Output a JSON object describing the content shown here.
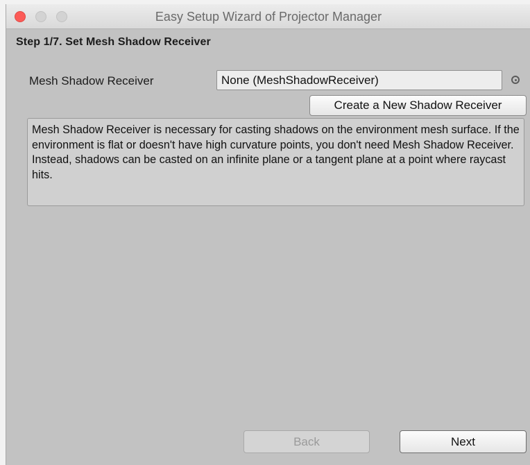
{
  "window": {
    "title": "Easy Setup Wizard of Projector Manager"
  },
  "step": {
    "label": "Step 1/7. Set Mesh Shadow Receiver"
  },
  "field": {
    "label": "Mesh Shadow Receiver",
    "value": "None (MeshShadowReceiver)"
  },
  "buttons": {
    "create": "Create a New Shadow Receiver",
    "back": "Back",
    "next": "Next"
  },
  "help": {
    "text": "Mesh Shadow Receiver is necessary for casting shadows on the environment mesh surface. If the environment is flat or doesn't have high curvature points, you don't need Mesh Shadow Receiver. Instead, shadows can be casted on an infinite plane or a tangent plane at a point where raycast hits."
  },
  "state": {
    "back_enabled": false
  },
  "colors": {
    "close_button": "#fc5b57",
    "window_background": "#c2c2c2"
  }
}
